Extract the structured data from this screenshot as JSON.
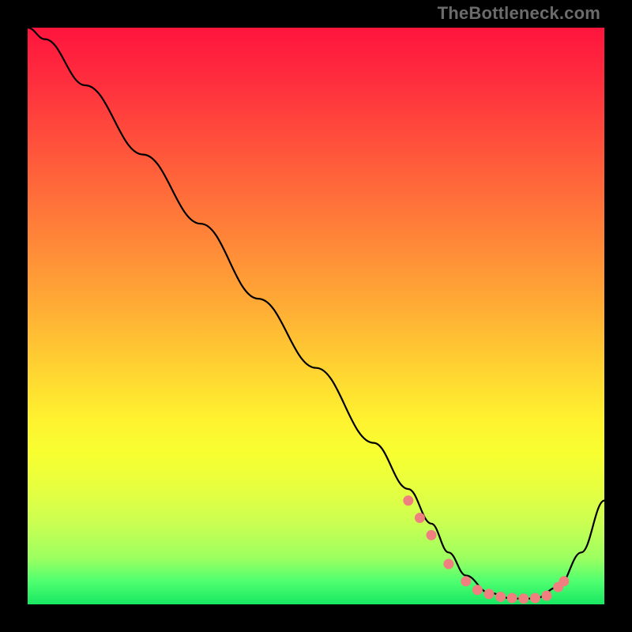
{
  "watermark": "TheBottleneck.com",
  "colors": {
    "curve_stroke": "#000000",
    "marker_fill": "#f08080",
    "marker_stroke": "#f08080",
    "background": "#000000"
  },
  "chart_data": {
    "type": "line",
    "title": "",
    "xlabel": "",
    "ylabel": "",
    "xlim": [
      0,
      100
    ],
    "ylim": [
      0,
      100
    ],
    "x": [
      0,
      3,
      10,
      20,
      30,
      40,
      50,
      60,
      66,
      70,
      73,
      76,
      80,
      84,
      88,
      92,
      96,
      100
    ],
    "values": [
      100,
      98,
      90,
      78,
      66,
      53,
      41,
      28,
      20,
      14,
      9,
      5,
      2,
      1,
      1,
      3,
      9,
      18
    ],
    "markers": {
      "x": [
        66,
        68,
        70,
        73,
        76,
        78,
        80,
        82,
        84,
        86,
        88,
        90,
        92,
        93
      ],
      "y": [
        18,
        15,
        12,
        7,
        4,
        2.5,
        1.8,
        1.3,
        1.1,
        1.0,
        1.1,
        1.5,
        3,
        4
      ]
    }
  }
}
